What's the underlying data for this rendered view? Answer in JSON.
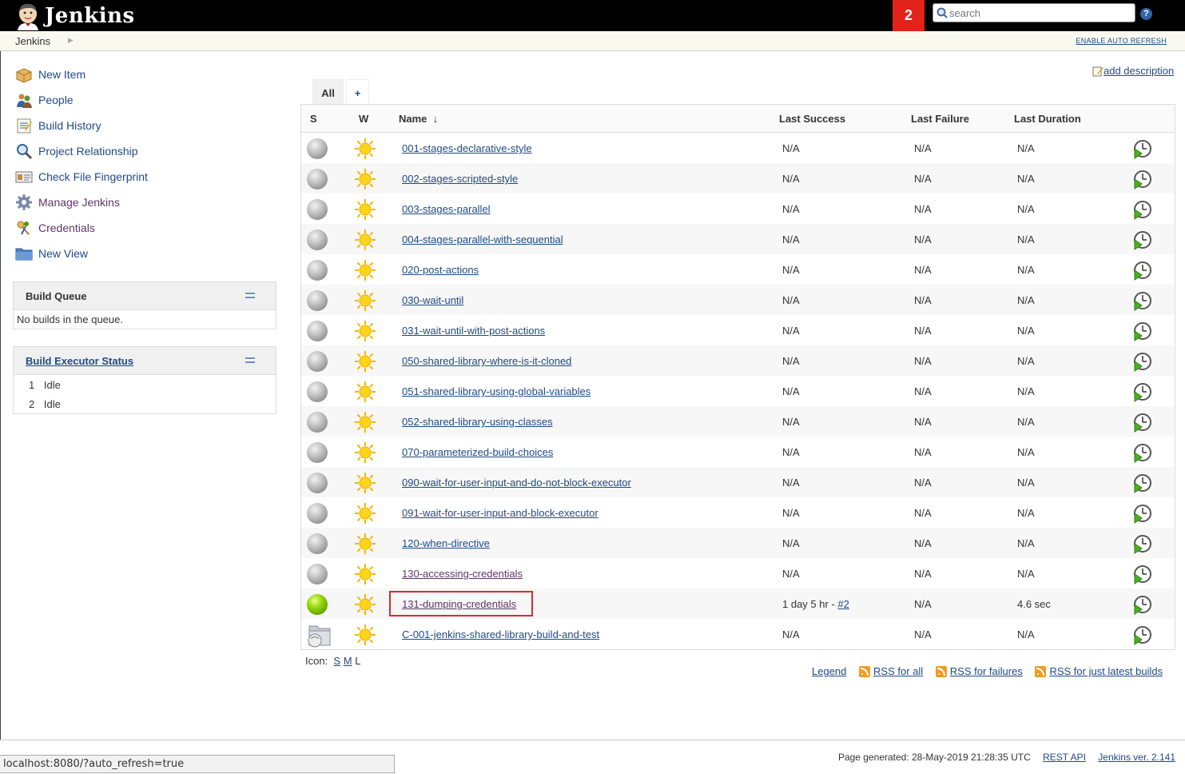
{
  "header": {
    "logo_text": "Jenkins",
    "notification_count": "2",
    "search_placeholder": "search",
    "help_icon": "question-mark-icon"
  },
  "breadcrumb": {
    "items": [
      "Jenkins"
    ],
    "auto_refresh": "ENABLE AUTO REFRESH"
  },
  "sidebar": {
    "tasks": [
      {
        "label": "New Item",
        "icon": "package-icon"
      },
      {
        "label": "People",
        "icon": "people-icon"
      },
      {
        "label": "Build History",
        "icon": "notepad-icon"
      },
      {
        "label": "Project Relationship",
        "icon": "magnifier-icon"
      },
      {
        "label": "Check File Fingerprint",
        "icon": "fingerprint-icon"
      },
      {
        "label": "Manage Jenkins",
        "icon": "gear-icon"
      },
      {
        "label": "Credentials",
        "icon": "keys-icon"
      },
      {
        "label": "New View",
        "icon": "folder-icon"
      }
    ],
    "build_queue": {
      "title": "Build Queue",
      "empty_message": "No builds in the queue."
    },
    "executors": {
      "title": "Build Executor Status",
      "rows": [
        {
          "number": "1",
          "status": "Idle"
        },
        {
          "number": "2",
          "status": "Idle"
        }
      ]
    }
  },
  "main": {
    "add_description": "add description",
    "tabs": [
      {
        "label": "All",
        "active": true
      },
      {
        "label": "+",
        "active": false
      }
    ],
    "columns": {
      "status": "S",
      "weather": "W",
      "name": "Name",
      "sort_indicator": "↓",
      "last_success": "Last Success",
      "last_failure": "Last Failure",
      "last_duration": "Last Duration"
    },
    "jobs": [
      {
        "name": "001-stages-declarative-style",
        "status": "grey",
        "last_success": "N/A",
        "last_failure": "N/A",
        "last_duration": "N/A"
      },
      {
        "name": "002-stages-scripted-style",
        "status": "grey",
        "last_success": "N/A",
        "last_failure": "N/A",
        "last_duration": "N/A"
      },
      {
        "name": "003-stages-parallel",
        "status": "grey",
        "last_success": "N/A",
        "last_failure": "N/A",
        "last_duration": "N/A"
      },
      {
        "name": "004-stages-parallel-with-sequential",
        "status": "grey",
        "last_success": "N/A",
        "last_failure": "N/A",
        "last_duration": "N/A"
      },
      {
        "name": "020-post-actions",
        "status": "grey",
        "last_success": "N/A",
        "last_failure": "N/A",
        "last_duration": "N/A"
      },
      {
        "name": "030-wait-until",
        "status": "grey",
        "last_success": "N/A",
        "last_failure": "N/A",
        "last_duration": "N/A"
      },
      {
        "name": "031-wait-until-with-post-actions",
        "status": "grey",
        "last_success": "N/A",
        "last_failure": "N/A",
        "last_duration": "N/A"
      },
      {
        "name": "050-shared-library-where-is-it-cloned",
        "status": "grey",
        "last_success": "N/A",
        "last_failure": "N/A",
        "last_duration": "N/A"
      },
      {
        "name": "051-shared-library-using-global-variables",
        "status": "grey",
        "last_success": "N/A",
        "last_failure": "N/A",
        "last_duration": "N/A"
      },
      {
        "name": "052-shared-library-using-classes",
        "status": "grey",
        "last_success": "N/A",
        "last_failure": "N/A",
        "last_duration": "N/A"
      },
      {
        "name": "070-parameterized-build-choices",
        "status": "grey",
        "last_success": "N/A",
        "last_failure": "N/A",
        "last_duration": "N/A"
      },
      {
        "name": "090-wait-for-user-input-and-do-not-block-executor",
        "status": "grey",
        "last_success": "N/A",
        "last_failure": "N/A",
        "last_duration": "N/A"
      },
      {
        "name": "091-wait-for-user-input-and-block-executor",
        "status": "grey",
        "last_success": "N/A",
        "last_failure": "N/A",
        "last_duration": "N/A"
      },
      {
        "name": "120-when-directive",
        "status": "grey",
        "last_success": "N/A",
        "last_failure": "N/A",
        "last_duration": "N/A"
      },
      {
        "name": "130-accessing-credentials",
        "status": "grey",
        "last_success": "N/A",
        "last_failure": "N/A",
        "last_duration": "N/A",
        "visited": true
      },
      {
        "name": "131-dumping-credentials",
        "status": "green",
        "last_success": "1 day 5 hr - ",
        "last_success_link": "#2",
        "last_failure": "N/A",
        "last_duration": "4.6 sec",
        "visited": true,
        "highlighted": true
      },
      {
        "name": "C-001-jenkins-shared-library-build-and-test",
        "status": "folder",
        "last_success": "N/A",
        "last_failure": "N/A",
        "last_duration": "N/A"
      }
    ],
    "icon_size": {
      "label": "Icon:",
      "options": [
        "S",
        "M",
        "L"
      ]
    },
    "legend_links": {
      "legend": "Legend",
      "rss_all": "RSS for all",
      "rss_failures": "RSS for failures",
      "rss_latest": "RSS for just latest builds"
    }
  },
  "footer": {
    "generated": "Page generated: 28-May-2019 21:28:35 UTC",
    "rest_api": "REST API",
    "version": "Jenkins ver. 2.141"
  },
  "status_bar": {
    "url": "localhost:8080/?auto_refresh=true"
  },
  "colors": {
    "header_bg": "#000000",
    "notification_bg": "#e2231a",
    "link": "#204a87",
    "visited_link": "#5c3566",
    "highlight_border": "#d32f2f"
  }
}
